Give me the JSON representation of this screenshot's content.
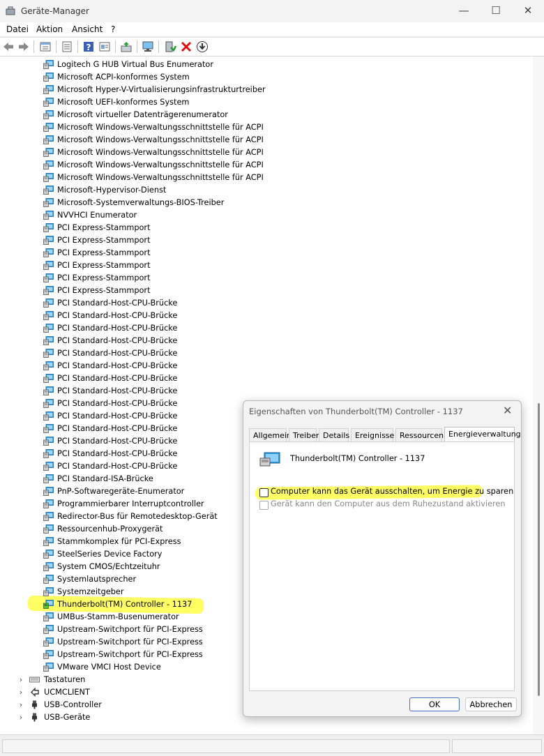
{
  "window": {
    "title": "Geräte-Manager",
    "controls": {
      "minimize": "—",
      "maximize": "☐",
      "close": "✕"
    }
  },
  "menu": [
    "Datei",
    "Aktion",
    "Ansicht",
    "?"
  ],
  "toolbar_icons": [
    "back-icon",
    "forward-icon",
    "properties-sheet-icon",
    "list-view-icon",
    "help-icon",
    "device-view-icon",
    "update-driver-icon",
    "scan-hardware-icon",
    "enable-device-icon",
    "uninstall-device-icon",
    "download-icon"
  ],
  "tree": {
    "system_devices": [
      "Logitech G HUB Virtual Bus Enumerator",
      "Microsoft ACPI-konformes System",
      "Microsoft Hyper-V-Virtualisierungsinfrastrukturtreiber",
      "Microsoft UEFI-konformes System",
      "Microsoft virtueller Datenträgerenumerator",
      "Microsoft Windows-Verwaltungsschnittstelle für ACPI",
      "Microsoft Windows-Verwaltungsschnittstelle für ACPI",
      "Microsoft Windows-Verwaltungsschnittstelle für ACPI",
      "Microsoft Windows-Verwaltungsschnittstelle für ACPI",
      "Microsoft Windows-Verwaltungsschnittstelle für ACPI",
      "Microsoft-Hypervisor-Dienst",
      "Microsoft-Systemverwaltungs-BIOS-Treiber",
      "NVVHCI Enumerator",
      "PCI Express-Stammport",
      "PCI Express-Stammport",
      "PCI Express-Stammport",
      "PCI Express-Stammport",
      "PCI Express-Stammport",
      "PCI Express-Stammport",
      "PCI Standard-Host-CPU-Brücke",
      "PCI Standard-Host-CPU-Brücke",
      "PCI Standard-Host-CPU-Brücke",
      "PCI Standard-Host-CPU-Brücke",
      "PCI Standard-Host-CPU-Brücke",
      "PCI Standard-Host-CPU-Brücke",
      "PCI Standard-Host-CPU-Brücke",
      "PCI Standard-Host-CPU-Brücke",
      "PCI Standard-Host-CPU-Brücke",
      "PCI Standard-Host-CPU-Brücke",
      "PCI Standard-Host-CPU-Brücke",
      "PCI Standard-Host-CPU-Brücke",
      "PCI Standard-Host-CPU-Brücke",
      "PCI Standard-Host-CPU-Brücke",
      "PCI Standard-ISA-Brücke",
      "PnP-Softwaregeräte-Enumerator",
      "Programmierbarer Interruptcontroller",
      "Redirector-Bus für Remotedesktop-Gerät",
      "Ressourcenhub-Proxygerät",
      "Stammkomplex für PCI-Express",
      "SteelSeries Device Factory",
      "System CMOS/Echtzeituhr",
      "Systemlautsprecher",
      "Systemzeitgeber",
      "Thunderbolt(TM) Controller - 1137",
      "UMBus-Stamm-Busenumerator",
      "Upstream-Switchport für PCI-Express",
      "Upstream-Switchport für PCI-Express",
      "Upstream-Switchport für PCI-Express",
      "VMware VMCI Host Device"
    ],
    "selected_device": "Thunderbolt(TM) Controller - 1137",
    "categories": [
      {
        "label": "Tastaturen",
        "icon": "keyboard-icon",
        "expander": "›"
      },
      {
        "label": "UCMCLIENT",
        "icon": "ucm-client-icon",
        "expander": "›"
      },
      {
        "label": "USB-Controller",
        "icon": "usb-icon",
        "expander": "›"
      },
      {
        "label": "USB-Geräte",
        "icon": "usb-icon",
        "expander": "›"
      }
    ]
  },
  "dialog": {
    "title": "Eigenschaften von Thunderbolt(TM) Controller - 1137",
    "close": "✕",
    "tabs": [
      "Allgemein",
      "Treiber",
      "Details",
      "Ereignisse",
      "Ressourcen",
      "Energieverwaltung"
    ],
    "active_tab": "Energieverwaltung",
    "device_name": "Thunderbolt(TM) Controller - 1137",
    "options": [
      {
        "label": "Computer kann das Gerät ausschalten, um Energie zu sparen",
        "checked": false,
        "enabled": true
      },
      {
        "label": "Gerät kann den Computer aus dem Ruhezustand aktivieren",
        "checked": false,
        "enabled": false
      }
    ],
    "ok_label": "OK",
    "cancel_label": "Abbrechen"
  },
  "colors": {
    "highlight": "#ffff30",
    "device_icon_blue": "#1e88d8",
    "uninstall_red": "#e01010"
  }
}
